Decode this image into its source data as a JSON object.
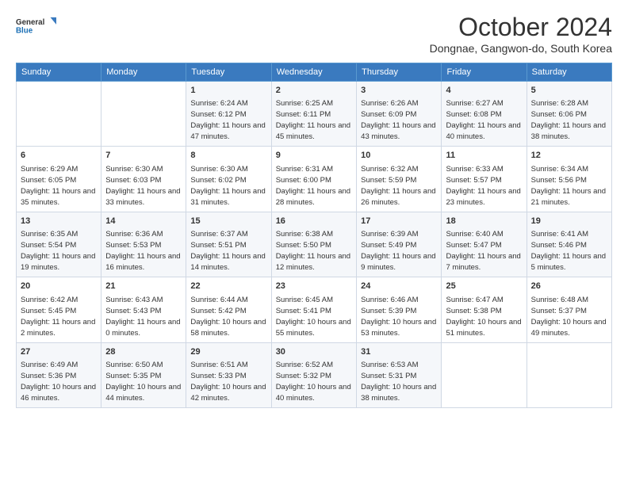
{
  "logo": {
    "line1": "General",
    "line2": "Blue"
  },
  "title": "October 2024",
  "location": "Dongnae, Gangwon-do, South Korea",
  "weekdays": [
    "Sunday",
    "Monday",
    "Tuesday",
    "Wednesday",
    "Thursday",
    "Friday",
    "Saturday"
  ],
  "weeks": [
    [
      {
        "day": "",
        "info": ""
      },
      {
        "day": "",
        "info": ""
      },
      {
        "day": "1",
        "info": "Sunrise: 6:24 AM\nSunset: 6:12 PM\nDaylight: 11 hours and 47 minutes."
      },
      {
        "day": "2",
        "info": "Sunrise: 6:25 AM\nSunset: 6:11 PM\nDaylight: 11 hours and 45 minutes."
      },
      {
        "day": "3",
        "info": "Sunrise: 6:26 AM\nSunset: 6:09 PM\nDaylight: 11 hours and 43 minutes."
      },
      {
        "day": "4",
        "info": "Sunrise: 6:27 AM\nSunset: 6:08 PM\nDaylight: 11 hours and 40 minutes."
      },
      {
        "day": "5",
        "info": "Sunrise: 6:28 AM\nSunset: 6:06 PM\nDaylight: 11 hours and 38 minutes."
      }
    ],
    [
      {
        "day": "6",
        "info": "Sunrise: 6:29 AM\nSunset: 6:05 PM\nDaylight: 11 hours and 35 minutes."
      },
      {
        "day": "7",
        "info": "Sunrise: 6:30 AM\nSunset: 6:03 PM\nDaylight: 11 hours and 33 minutes."
      },
      {
        "day": "8",
        "info": "Sunrise: 6:30 AM\nSunset: 6:02 PM\nDaylight: 11 hours and 31 minutes."
      },
      {
        "day": "9",
        "info": "Sunrise: 6:31 AM\nSunset: 6:00 PM\nDaylight: 11 hours and 28 minutes."
      },
      {
        "day": "10",
        "info": "Sunrise: 6:32 AM\nSunset: 5:59 PM\nDaylight: 11 hours and 26 minutes."
      },
      {
        "day": "11",
        "info": "Sunrise: 6:33 AM\nSunset: 5:57 PM\nDaylight: 11 hours and 23 minutes."
      },
      {
        "day": "12",
        "info": "Sunrise: 6:34 AM\nSunset: 5:56 PM\nDaylight: 11 hours and 21 minutes."
      }
    ],
    [
      {
        "day": "13",
        "info": "Sunrise: 6:35 AM\nSunset: 5:54 PM\nDaylight: 11 hours and 19 minutes."
      },
      {
        "day": "14",
        "info": "Sunrise: 6:36 AM\nSunset: 5:53 PM\nDaylight: 11 hours and 16 minutes."
      },
      {
        "day": "15",
        "info": "Sunrise: 6:37 AM\nSunset: 5:51 PM\nDaylight: 11 hours and 14 minutes."
      },
      {
        "day": "16",
        "info": "Sunrise: 6:38 AM\nSunset: 5:50 PM\nDaylight: 11 hours and 12 minutes."
      },
      {
        "day": "17",
        "info": "Sunrise: 6:39 AM\nSunset: 5:49 PM\nDaylight: 11 hours and 9 minutes."
      },
      {
        "day": "18",
        "info": "Sunrise: 6:40 AM\nSunset: 5:47 PM\nDaylight: 11 hours and 7 minutes."
      },
      {
        "day": "19",
        "info": "Sunrise: 6:41 AM\nSunset: 5:46 PM\nDaylight: 11 hours and 5 minutes."
      }
    ],
    [
      {
        "day": "20",
        "info": "Sunrise: 6:42 AM\nSunset: 5:45 PM\nDaylight: 11 hours and 2 minutes."
      },
      {
        "day": "21",
        "info": "Sunrise: 6:43 AM\nSunset: 5:43 PM\nDaylight: 11 hours and 0 minutes."
      },
      {
        "day": "22",
        "info": "Sunrise: 6:44 AM\nSunset: 5:42 PM\nDaylight: 10 hours and 58 minutes."
      },
      {
        "day": "23",
        "info": "Sunrise: 6:45 AM\nSunset: 5:41 PM\nDaylight: 10 hours and 55 minutes."
      },
      {
        "day": "24",
        "info": "Sunrise: 6:46 AM\nSunset: 5:39 PM\nDaylight: 10 hours and 53 minutes."
      },
      {
        "day": "25",
        "info": "Sunrise: 6:47 AM\nSunset: 5:38 PM\nDaylight: 10 hours and 51 minutes."
      },
      {
        "day": "26",
        "info": "Sunrise: 6:48 AM\nSunset: 5:37 PM\nDaylight: 10 hours and 49 minutes."
      }
    ],
    [
      {
        "day": "27",
        "info": "Sunrise: 6:49 AM\nSunset: 5:36 PM\nDaylight: 10 hours and 46 minutes."
      },
      {
        "day": "28",
        "info": "Sunrise: 6:50 AM\nSunset: 5:35 PM\nDaylight: 10 hours and 44 minutes."
      },
      {
        "day": "29",
        "info": "Sunrise: 6:51 AM\nSunset: 5:33 PM\nDaylight: 10 hours and 42 minutes."
      },
      {
        "day": "30",
        "info": "Sunrise: 6:52 AM\nSunset: 5:32 PM\nDaylight: 10 hours and 40 minutes."
      },
      {
        "day": "31",
        "info": "Sunrise: 6:53 AM\nSunset: 5:31 PM\nDaylight: 10 hours and 38 minutes."
      },
      {
        "day": "",
        "info": ""
      },
      {
        "day": "",
        "info": ""
      }
    ]
  ]
}
